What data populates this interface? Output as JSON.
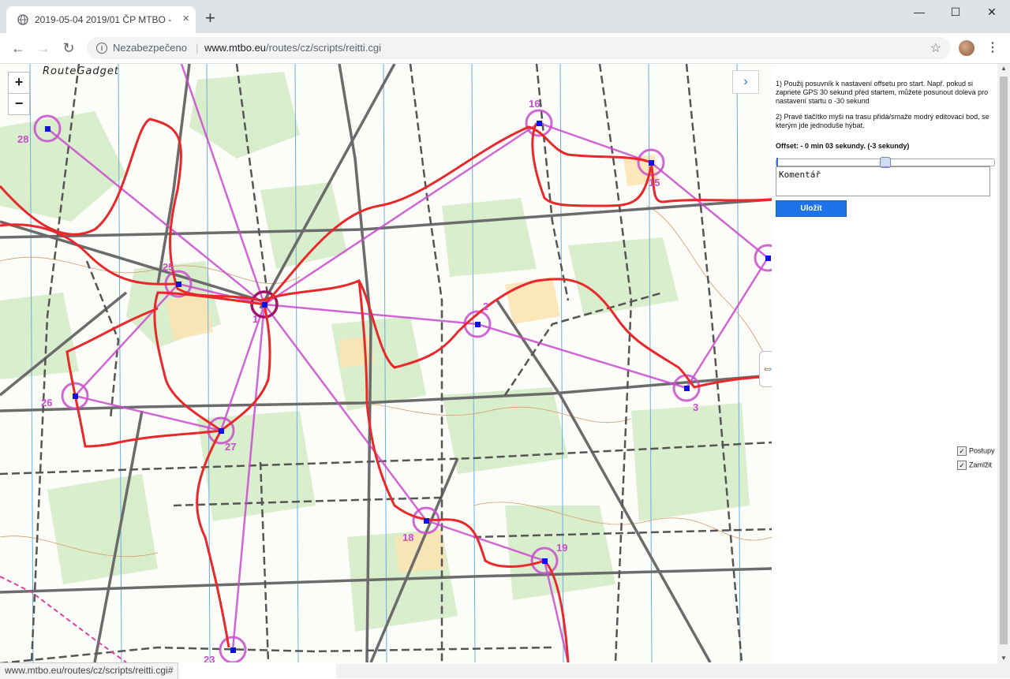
{
  "browser": {
    "tab_title": "2019-05-04 2019/01 ČP MTBO - ",
    "insecure_label": "Nezabezpečeno",
    "url_host": "www.mtbo.eu",
    "url_path": "/routes/cz/scripts/reitti.cgi",
    "status_url": "www.mtbo.eu/routes/cz/scripts/reitti.cgi#"
  },
  "map": {
    "logo": "RouteGadget",
    "zoom_in": "+",
    "zoom_out": "−",
    "controls": [
      {
        "label": "1"
      },
      {
        "label": "2"
      },
      {
        "label": "3"
      },
      {
        "label": "15"
      },
      {
        "label": "16"
      },
      {
        "label": "19"
      },
      {
        "label": "18"
      },
      {
        "label": "23"
      },
      {
        "label": "25"
      },
      {
        "label": "26"
      },
      {
        "label": "27"
      },
      {
        "label": "28"
      }
    ]
  },
  "panel": {
    "help_1": "1) Použij posuvník k nastavení offsetu pro start. Např. pokud si zapnete GPS 30 sekund před startem, můžete posunout doleva pro nastavení startu o -30 sekund",
    "help_2": "2) Pravé tlačítko myši na trasu přidá/smaže modrý editovací bod, se kterým jde jednoduše hýbat.",
    "offset_label": "Offset: - 0 min 03 sekundy. (-3 sekundy)",
    "comment_placeholder": "Komentář",
    "save_label": "Uložit",
    "checkbox_legs": "Postupy",
    "checkbox_lock": "Zamlžit"
  },
  "colors": {
    "route": "#e8282a",
    "course": "#c84ccd",
    "accent": "#1e73e8"
  }
}
